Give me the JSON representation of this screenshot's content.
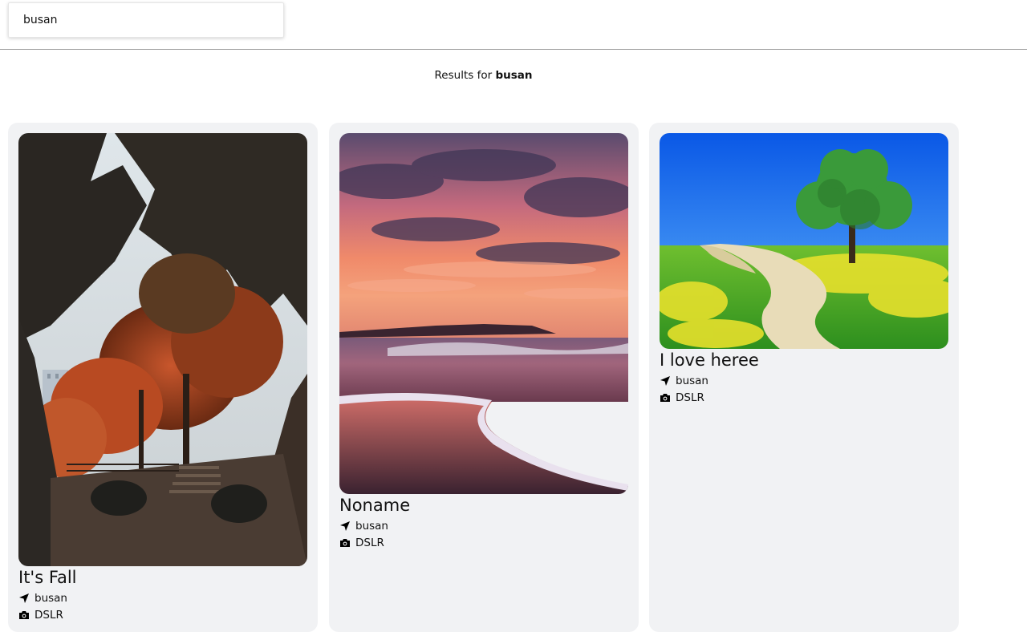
{
  "search": {
    "value": "busan",
    "icon": "none"
  },
  "results": {
    "prefix": "Results for",
    "query": "busan"
  },
  "cards": [
    {
      "title": "It's Fall",
      "location": "busan",
      "camera": "DSLR",
      "image": "autumn-trees-stairs-photo"
    },
    {
      "title": "Noname",
      "location": "busan",
      "camera": "DSLR",
      "image": "sunset-beach-waves-photo"
    },
    {
      "title": "I love heree",
      "location": "busan",
      "camera": "DSLR",
      "image": "tree-path-meadow-photo"
    }
  ],
  "colors": {
    "card_bg": "#f1f2f4",
    "divider": "#9a9a9a"
  }
}
